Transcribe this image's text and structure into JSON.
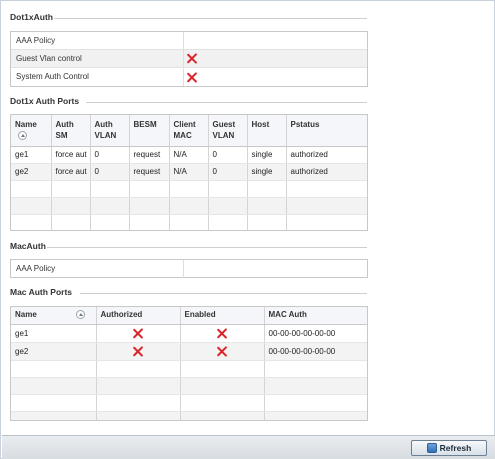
{
  "dot1x_auth": {
    "title": "Dot1xAuth",
    "rows": [
      {
        "label": "AAA Policy",
        "value": ""
      },
      {
        "label": "Guest Vlan control",
        "value_icon": "red-x-icon"
      },
      {
        "label": "System Auth Control",
        "value_icon": "red-x-icon"
      }
    ]
  },
  "dot1x_ports": {
    "title": "Dot1x Auth Ports",
    "columns": [
      "Name",
      "Auth SM",
      "Auth VLAN",
      "BESM",
      "Client MAC",
      "Guest VLAN",
      "Host",
      "Pstatus"
    ],
    "rows": [
      [
        "ge1",
        "force aut",
        "0",
        "request",
        "N/A",
        "0",
        "single",
        "authorized"
      ],
      [
        "ge2",
        "force aut",
        "0",
        "request",
        "N/A",
        "0",
        "single",
        "authorized"
      ]
    ]
  },
  "mac_auth": {
    "title": "MacAuth",
    "rows": [
      {
        "label": "AAA Policy",
        "value": ""
      }
    ]
  },
  "mac_ports": {
    "title": "Mac Auth Ports",
    "columns": [
      "Name",
      "Authorized",
      "Enabled",
      "MAC Auth"
    ],
    "rows": [
      {
        "name": "ge1",
        "authorized_icon": "red-x-icon",
        "enabled_icon": "red-x-icon",
        "mac": "00-00-00-00-00-00"
      },
      {
        "name": "ge2",
        "authorized_icon": "red-x-icon",
        "enabled_icon": "red-x-icon",
        "mac": "00-00-00-00-00-00"
      }
    ]
  },
  "footer": {
    "refresh_label": "Refresh"
  },
  "colors": {
    "x_mark": "#d8262b",
    "header_bg": "#f4f6f9",
    "alt_row": "#f3f3f3"
  }
}
